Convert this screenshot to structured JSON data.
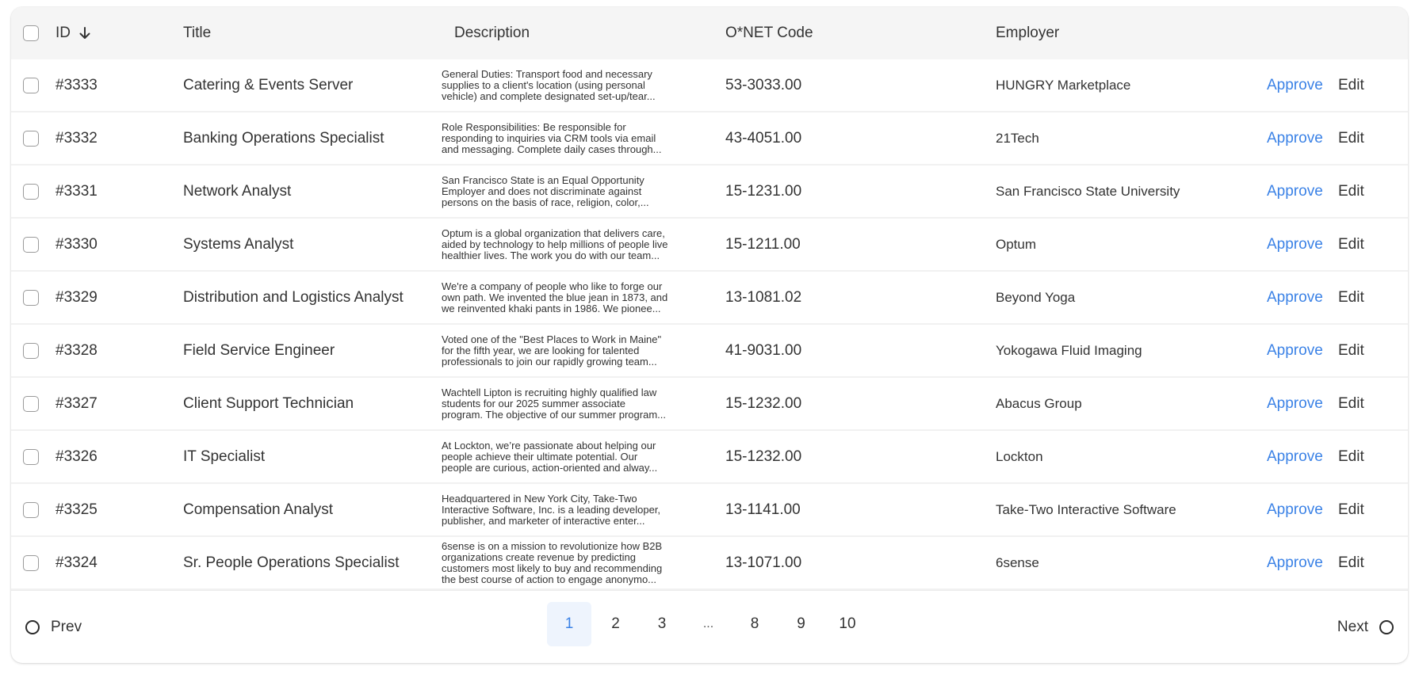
{
  "table": {
    "headers": {
      "id": "ID",
      "title": "Title",
      "description": "Description",
      "onet": "O*NET Code",
      "employer": "Employer"
    },
    "sort": {
      "column": "ID",
      "direction": "descending",
      "icon": "arrow-down-icon"
    },
    "actions": {
      "approve": "Approve",
      "edit": "Edit"
    },
    "colors": {
      "approve": "#3b82e6",
      "header_bg": "#f5f5f5",
      "active_page_bg": "#eef4fd"
    },
    "rows": [
      {
        "id": "#3333",
        "title": "Catering & Events Server",
        "description": [
          "General Duties: Transport food and necessary",
          "supplies to a client's location (using personal",
          "vehicle) and complete designated set-up/tear..."
        ],
        "onet": "53-3033.00",
        "employer": "HUNGRY Marketplace"
      },
      {
        "id": "#3332",
        "title": "Banking Operations Specialist",
        "description": [
          "Role Responsibilities: Be responsible for",
          "responding to inquiries via CRM tools via email",
          "and messaging. Complete daily cases through..."
        ],
        "onet": "43-4051.00",
        "employer": "21Tech"
      },
      {
        "id": "#3331",
        "title": "Network Analyst",
        "description": [
          "San Francisco State is an Equal Opportunity",
          "Employer and does not discriminate against",
          "persons on the basis of race, religion, color,..."
        ],
        "onet": "15-1231.00",
        "employer": "San Francisco State University"
      },
      {
        "id": "#3330",
        "title": "Systems Analyst",
        "description": [
          "Optum is a global organization that delivers care,",
          "aided by technology to help millions of people live",
          "healthier lives. The work you do with our team..."
        ],
        "onet": "15-1211.00",
        "employer": "Optum"
      },
      {
        "id": "#3329",
        "title": "Distribution and Logistics Analyst",
        "description": [
          "We're a company of people who like to forge our",
          "own path. We invented the blue jean in 1873, and",
          "we reinvented khaki pants in 1986. We pionee..."
        ],
        "onet": "13-1081.02",
        "employer": "Beyond Yoga"
      },
      {
        "id": "#3328",
        "title": "Field Service Engineer",
        "description": [
          "Voted one of the \"Best Places to Work in Maine\"",
          "for the fifth year, we are looking for talented",
          "professionals to join our rapidly growing team..."
        ],
        "onet": "41-9031.00",
        "employer": "Yokogawa Fluid Imaging"
      },
      {
        "id": "#3327",
        "title": "Client Support Technician",
        "description": [
          "Wachtell Lipton is recruiting highly qualified law",
          "students for our 2025 summer associate",
          "program. The objective of our summer program..."
        ],
        "onet": "15-1232.00",
        "employer": "Abacus Group"
      },
      {
        "id": "#3326",
        "title": "IT Specialist",
        "description": [
          "At Lockton, we’re passionate about helping our",
          "people achieve their ultimate potential. Our",
          "people are curious, action-oriented and alway..."
        ],
        "onet": "15-1232.00",
        "employer": "Lockton"
      },
      {
        "id": "#3325",
        "title": "Compensation Analyst",
        "description": [
          "Headquartered in New York City, Take-Two",
          "Interactive Software, Inc. is a leading developer,",
          "publisher, and marketer of interactive enter..."
        ],
        "onet": "13-1141.00",
        "employer": "Take-Two Interactive Software"
      },
      {
        "id": "#3324",
        "title": "Sr. People Operations Specialist",
        "description": [
          "6sense is on a mission to revolutionize how B2B",
          "organizations create revenue by predicting",
          "customers most likely to buy and recommending",
          "the best course of action to engage anonymo..."
        ],
        "onet": "13-1071.00",
        "employer": "6sense"
      }
    ]
  },
  "pagination": {
    "prev_label": "Prev",
    "next_label": "Next",
    "current_page": "1",
    "pages": [
      "1",
      "2",
      "3",
      "...",
      "8",
      "9",
      "10"
    ]
  }
}
